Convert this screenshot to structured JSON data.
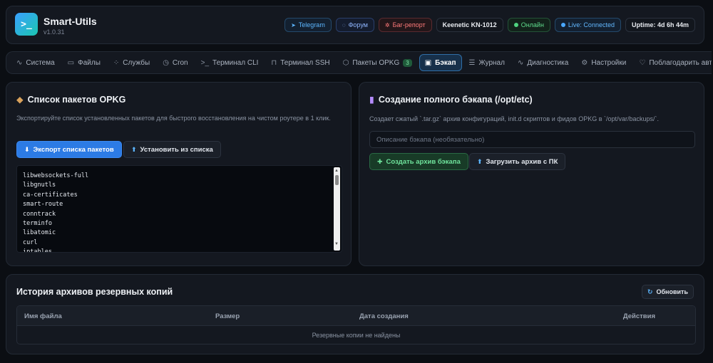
{
  "header": {
    "logo": ">_",
    "title": "Smart-Utils",
    "version": "v1.0.31",
    "badges": {
      "telegram": "Telegram",
      "forum": "Форум",
      "bug": "Баг-репорт",
      "model": "Keenetic KN-1012",
      "online": "Онлайн",
      "live": "Live: Connected",
      "uptime": "Uptime: 4d 6h 44m"
    }
  },
  "tabs": {
    "system": "Система",
    "files": "Файлы",
    "services": "Службы",
    "cron": "Cron",
    "cli": "Терминал CLI",
    "ssh": "Терминал SSH",
    "opkg": "Пакеты OPKG",
    "opkg_count": "3",
    "backup": "Бэкап",
    "journal": "Журнал",
    "diagnostics": "Диагностика",
    "settings": "Настройки",
    "thanks": "Поблагодарить автора"
  },
  "opkg": {
    "title": "Список пакетов OPKG",
    "description": "Экспортируйте список установленных пакетов для быстрого восстановления на чистом роутере в 1 клик.",
    "export_button": "Экспорт списка пакетов",
    "install_button": "Установить из списка",
    "packages": [
      "libwebsockets-full",
      "libgnutls",
      "ca-certificates",
      "smart-route",
      "conntrack",
      "terminfo",
      "libatomic",
      "curl",
      "iptables"
    ]
  },
  "backup": {
    "title": "Создание полного бэкапа (/opt/etc)",
    "description": "Создает сжатый `.tar.gz` архив конфигураций, init.d скриптов и фидов OPKG в `/opt/var/backups/`.",
    "placeholder": "Описание бэкапа (необязательно)",
    "create_button": "Создать архив бэкапа",
    "upload_button": "Загрузить архив с ПК"
  },
  "history": {
    "title": "История архивов резервных копий",
    "refresh_button": "Обновить",
    "columns": {
      "filename": "Имя файла",
      "size": "Размер",
      "created": "Дата создания",
      "actions": "Действия"
    },
    "empty": "Резервные копии не найдены"
  },
  "colors": {
    "accent": "#2c7be5",
    "success": "#5fdc8c",
    "danger": "#ff7a7a",
    "background": "#0b0e13",
    "panel": "#141820"
  }
}
